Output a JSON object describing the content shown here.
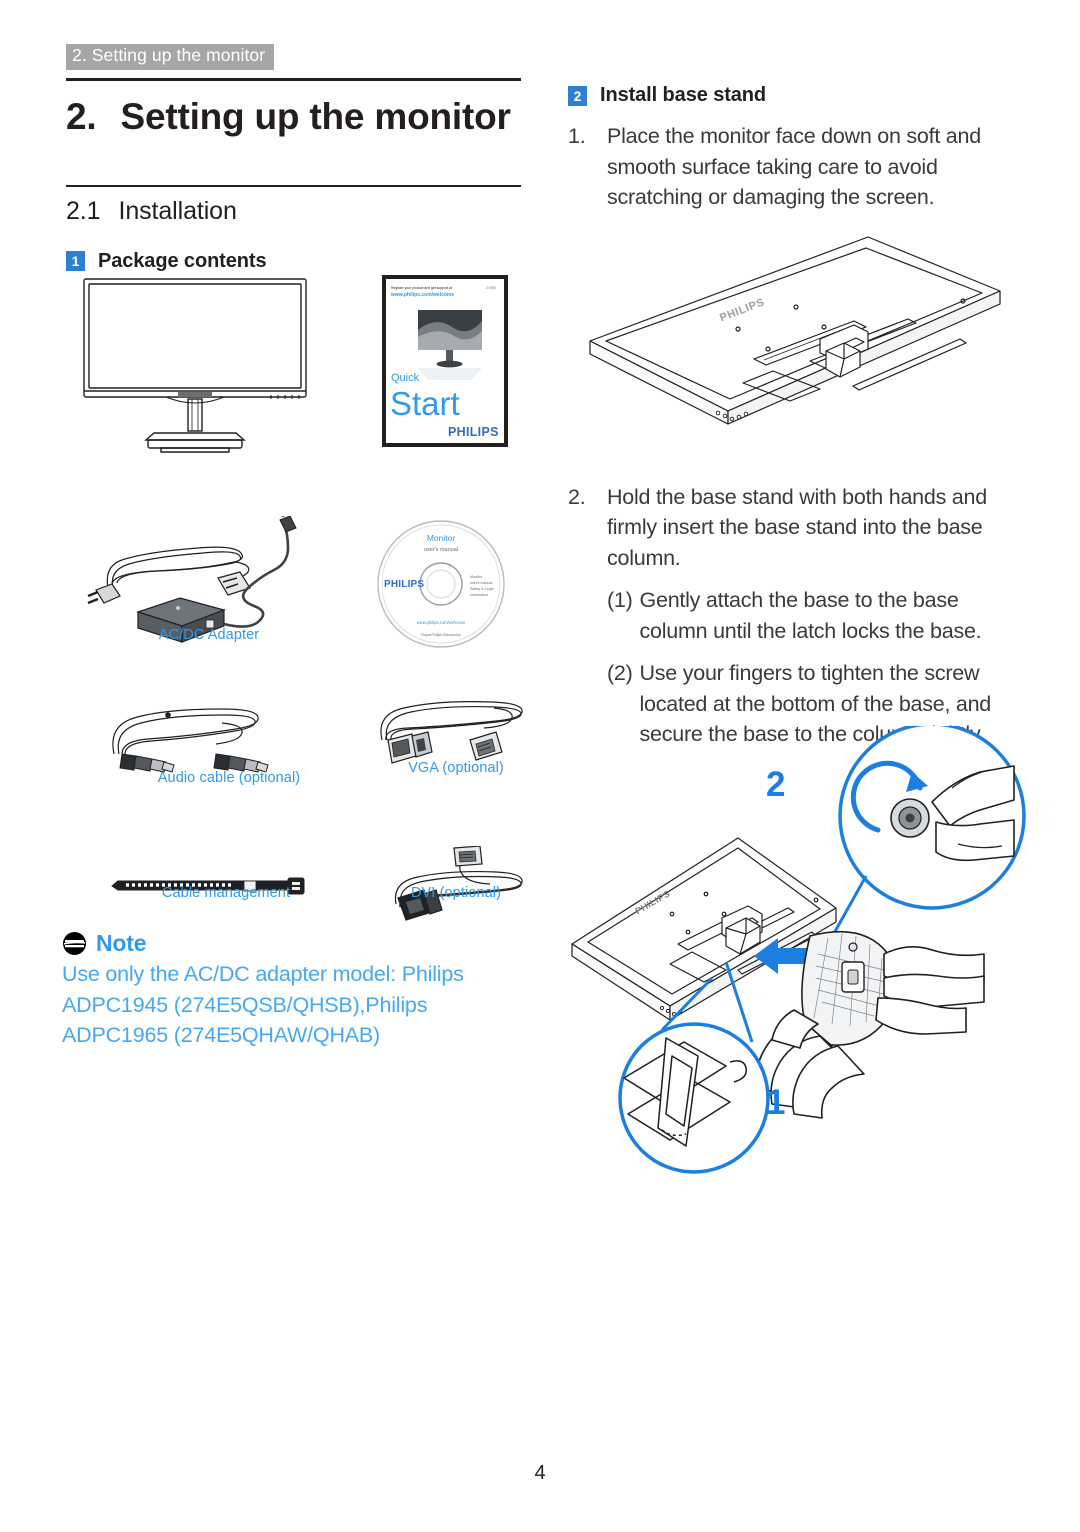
{
  "document": {
    "running_header": "2. Setting up the monitor",
    "page_number": "4"
  },
  "left_column": {
    "chapter_number": "2.",
    "chapter_title": "Setting up the monitor",
    "section_number": "2.1",
    "section_title": "Installation",
    "subsection_badge": "1",
    "subsection_title": "Package contents",
    "package_items": [
      {
        "name": "monitor-illustration",
        "caption": ""
      },
      {
        "name": "quick-start-guide",
        "caption": ""
      },
      {
        "name": "ac-dc-adapter",
        "caption": "AC/DC Adapter"
      },
      {
        "name": "cd-user-manual",
        "caption": ""
      },
      {
        "name": "audio-cable",
        "caption": "Audio cable (optional)"
      },
      {
        "name": "vga-cable",
        "caption": "VGA (optional)"
      },
      {
        "name": "cable-management",
        "caption": "Cable management"
      },
      {
        "name": "dvi-cable",
        "caption": "DVI (optional)"
      }
    ],
    "quick_start": {
      "tagline": "Register your product and get support at",
      "url": "www.philips.com/welcome",
      "model": "274E5",
      "word_quick": "Quick",
      "word_start": "Start",
      "brand": "PHILIPS"
    },
    "cd_label": {
      "line1": "Monitor",
      "line2": "user's manual",
      "brand": "PHILIPS",
      "url": "www.philips.com/welcome"
    },
    "note": {
      "title": "Note",
      "line1": "Use only the AC/DC adapter model: Philips",
      "line2": "ADPC1945 (274E5QSB/QHSB),Philips",
      "line3": "ADPC1965 (274E5QHAW/QHAB)"
    }
  },
  "right_column": {
    "badge": "2",
    "heading": "Install base stand",
    "steps": [
      {
        "number": "1.",
        "text": "Place the monitor face down on soft and smooth surface taking care to avoid scratching or damaging the screen."
      },
      {
        "number": "2.",
        "text": "Hold the base stand with both hands and firmly insert the base stand into the base column."
      }
    ],
    "substeps": [
      {
        "number": "(1)",
        "text": "Gently attach the base to the base column until the latch locks the base."
      },
      {
        "number": "(2)",
        "text": "Use your fingers to tighten the screw located at the bottom of the base, and secure the base to the column tightly."
      }
    ],
    "figure_labels": {
      "callout_1": "1",
      "callout_2": "2",
      "monitor_brand": "PHILIPS"
    }
  },
  "colors": {
    "accent_blue": "#2e9bef",
    "badge_blue": "#2d7fd3",
    "header_gray": "#a6a6a6",
    "text_dark": "#231f20",
    "note_blue": "#45a8f5"
  }
}
